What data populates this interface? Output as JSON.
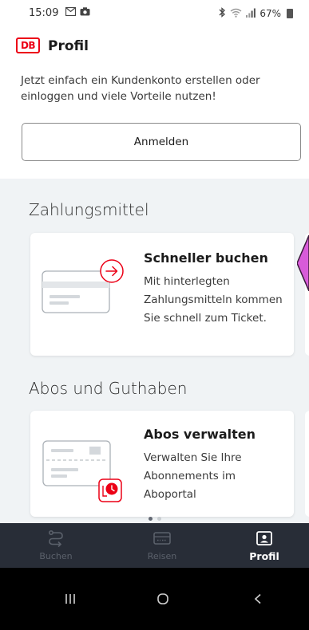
{
  "status_bar": {
    "time": "15:09",
    "battery": "67%",
    "icons": [
      "gmail-icon",
      "camera-icon",
      "bluetooth-icon",
      "wifi-icon",
      "signal-icon",
      "battery-icon"
    ]
  },
  "header": {
    "logo_text": "DB",
    "title": "Profil",
    "intro_text": "Jetzt einfach ein Kundenkonto erstellen oder einloggen und viele Vorteile nutzen!",
    "login_button": "Anmelden"
  },
  "sections": [
    {
      "title": "Zahlungsmittel",
      "card": {
        "title": "Schneller buchen",
        "description": "Mit hinterlegten Zahlungsmitteln kommen Sie schnell zum Ticket.",
        "icon": "payment-card-arrow-icon"
      }
    },
    {
      "title": "Abos und Guthaben",
      "card": {
        "title": "Abos verwalten",
        "description": "Verwalten Sie Ihre Abonnements im Aboportal",
        "icon": "subscription-card-clock-icon"
      }
    }
  ],
  "pager": {
    "pages": 2,
    "active_page": 1
  },
  "bottom_nav": [
    {
      "label": "Buchen",
      "icon": "route-icon",
      "active": false
    },
    {
      "label": "Reisen",
      "icon": "ticket-icon",
      "active": false
    },
    {
      "label": "Profil",
      "icon": "profile-icon",
      "active": true
    }
  ],
  "system_nav": [
    "recents-icon",
    "home-icon",
    "back-icon"
  ],
  "colors": {
    "brand_red": "#ec0016",
    "nav_background": "#282d37",
    "content_background": "#f0f3f5",
    "annotation_arrow": "#d85bd9"
  }
}
